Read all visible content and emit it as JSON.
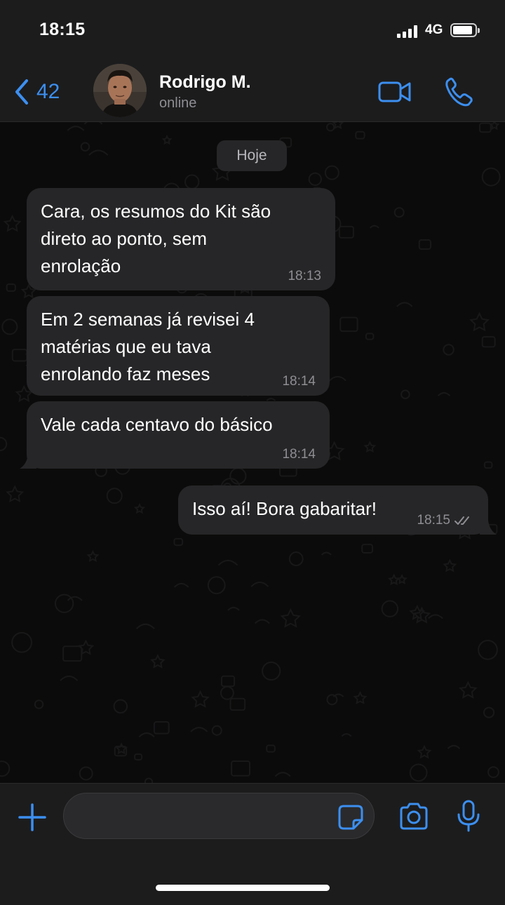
{
  "status_bar": {
    "time": "18:15",
    "network": "4G",
    "signal_bars": 4,
    "battery_level": 0.8
  },
  "header": {
    "back_count": "42",
    "contact_name": "Rodrigo M.",
    "contact_status": "online"
  },
  "chat": {
    "date_label": "Hoje",
    "messages": [
      {
        "direction": "in",
        "lines": [
          "Cara, os resumos do Kit são",
          "direto ao ponto, sem",
          "enrolação"
        ],
        "time": "18:13"
      },
      {
        "direction": "in",
        "lines": [
          "Em 2 semanas já revisei 4",
          "matérias que eu tava",
          "enrolando faz meses"
        ],
        "time": "18:14"
      },
      {
        "direction": "in",
        "lines": [
          "Vale cada centavo do básico"
        ],
        "time": "18:14"
      },
      {
        "direction": "out",
        "lines": [
          "Isso aí! Bora gabaritar!"
        ],
        "time": "18:15",
        "status": "read"
      }
    ]
  },
  "composer": {
    "input_value": "",
    "input_placeholder": ""
  },
  "icons": {
    "back": "chevron-left-icon",
    "video": "video-call-icon",
    "phone": "phone-icon",
    "plus": "plus-icon",
    "sticker": "sticker-icon",
    "camera": "camera-icon",
    "mic": "microphone-icon",
    "read": "double-check-icon"
  },
  "colors": {
    "accent": "#3c8ff0",
    "bubble": "#262628",
    "bar": "#1c1c1d",
    "background": "#0b0b0b"
  }
}
